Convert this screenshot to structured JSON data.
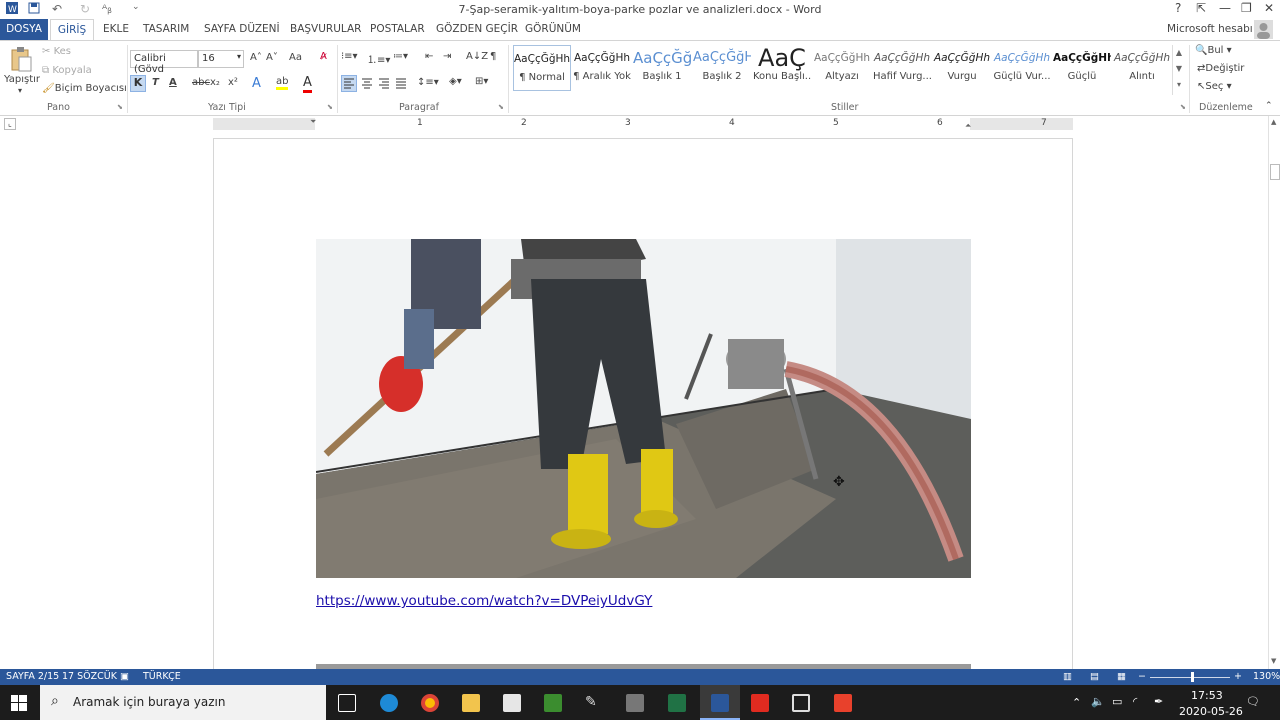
{
  "window": {
    "title": "7-Şap-seramik-yalıtım-boya-parke pozlar ve analizleri.docx - Word",
    "help": "?",
    "minimize": "—",
    "restore": "❐",
    "close": "✕"
  },
  "tabs": {
    "file": "DOSYA",
    "items": [
      "GİRİŞ",
      "EKLE",
      "TASARIM",
      "SAYFA DÜZENİ",
      "BAŞVURULAR",
      "POSTALAR",
      "GÖZDEN GEÇİR",
      "GÖRÜNÜM"
    ],
    "account": "Microsoft hesabı"
  },
  "ribbon": {
    "clipboard": {
      "paste": "Yapıştır",
      "cut": "Kes",
      "copy": "Kopyala",
      "format_painter": "Biçim Boyacısı",
      "label": "Pano"
    },
    "font": {
      "name": "Calibri (Gövd",
      "size": "16",
      "bold": "K",
      "italic": "T",
      "underline": "A",
      "strike": "abc",
      "sub": "x₂",
      "sup": "x²",
      "grow": "A˄",
      "shrink": "A˅",
      "case": "Aa",
      "label": "Yazı Tipi"
    },
    "paragraph": {
      "label": "Paragraf"
    },
    "styles": {
      "label": "Stiller",
      "items": [
        {
          "preview": "AaÇçĞğHh",
          "name": "¶ Normal"
        },
        {
          "preview": "AaÇçĞğHh",
          "name": "¶ Aralık Yok"
        },
        {
          "preview": "AaÇçĞğ",
          "name": "Başlık 1"
        },
        {
          "preview": "AaÇçĞğH",
          "name": "Başlık 2"
        },
        {
          "preview": "AaÇ",
          "name": "Konu Başlı..."
        },
        {
          "preview": "AaÇçĞğHh",
          "name": "Altyazı"
        },
        {
          "preview": "AaÇçĞğHh",
          "name": "Hafif Vurg..."
        },
        {
          "preview": "AaÇçĞğHh",
          "name": "Vurgu"
        },
        {
          "preview": "AaÇçĞğHh",
          "name": "Güçlü Vur..."
        },
        {
          "preview": "AaÇçĞğHh",
          "name": "Güçlü"
        },
        {
          "preview": "AaÇçĞğHh",
          "name": "Alıntı"
        }
      ]
    },
    "editing": {
      "find": "Bul",
      "replace": "Değiştir",
      "select": "Seç",
      "label": "Düzenleme"
    }
  },
  "ruler": {
    "numbers": [
      "1",
      "2",
      "3",
      "4",
      "5",
      "6",
      "7"
    ]
  },
  "document": {
    "link": "https://www.youtube.com/watch?v=DVPeiyUdvGY"
  },
  "statusbar": {
    "page": "SAYFA 2/15",
    "words": "17 SÖZCÜK",
    "language": "TÜRKÇE",
    "zoom": "130%"
  },
  "taskbar": {
    "search_placeholder": "Aramak için buraya yazın",
    "time": "17:53",
    "date": "2020-05-26"
  },
  "colors": {
    "word_blue": "#2b579a",
    "link": "#1a0dab"
  }
}
